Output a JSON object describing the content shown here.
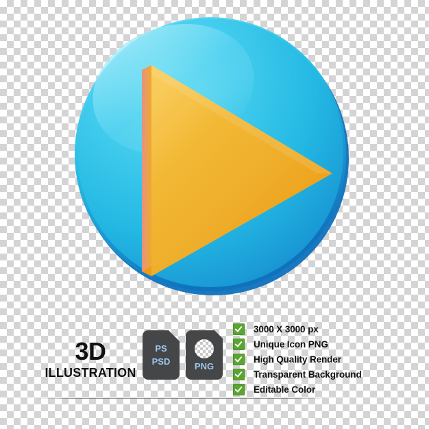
{
  "artwork": {
    "name": "3d-play-button-icon",
    "description": "3D glossy blue circle with orange play triangle",
    "colors": {
      "circle_light": "#4fd2ef",
      "circle_mid": "#29bde4",
      "circle_dark": "#1b96d4",
      "circle_deep": "#1379c4",
      "triangle_light": "#f6c145",
      "triangle_mid": "#edaf2e",
      "triangle_dark": "#f0960f",
      "triangle_bevel": "#e08a6b"
    }
  },
  "brand": {
    "line1": "3D",
    "line2": "ILLUSTRATION"
  },
  "badges": [
    {
      "name": "ps-psd-badge",
      "lines": [
        "PS",
        "PSD"
      ],
      "icon": "file-badge-icon",
      "color": "#444648",
      "text_color": "#9ec7ee"
    },
    {
      "name": "png-badge",
      "lines": [
        "PNG"
      ],
      "icon": "transparent-circle-icon",
      "color": "#444648",
      "text_color": "#9ec7ee"
    }
  ],
  "features": [
    {
      "icon": "check-icon",
      "label": "3000 X 3000 px"
    },
    {
      "icon": "check-icon",
      "label": "Unique Icon PNG"
    },
    {
      "icon": "check-icon",
      "label": "High Quality Render"
    },
    {
      "icon": "check-icon",
      "label": "Transparent Background"
    },
    {
      "icon": "check-icon",
      "label": "Editable Color"
    }
  ],
  "check_color": "#5aa530"
}
